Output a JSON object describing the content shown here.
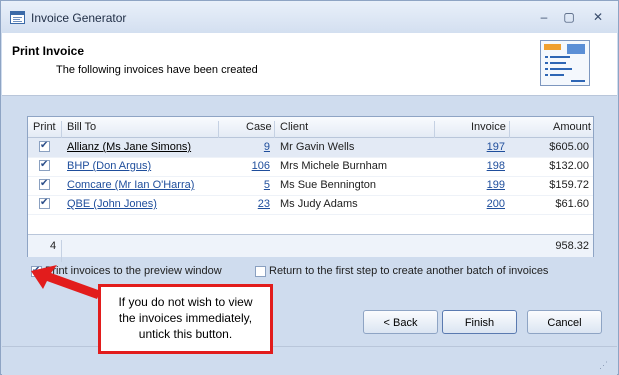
{
  "window": {
    "title": "Invoice Generator",
    "minimize": "–",
    "restore": "▢",
    "close": "✕"
  },
  "header": {
    "title": "Print Invoice",
    "subtitle": "The following invoices have been created"
  },
  "grid": {
    "columns": {
      "print": "Print",
      "bill_to": "Bill To",
      "case": "Case",
      "client": "Client",
      "invoice": "Invoice",
      "amount": "Amount"
    },
    "rows": [
      {
        "print": true,
        "bill_to": "Allianz (Ms Jane Simons)",
        "case": "9",
        "client": "Mr Gavin Wells",
        "invoice": "197",
        "amount": "$605.00"
      },
      {
        "print": true,
        "bill_to": "BHP (Don Argus)",
        "case": "106",
        "client": "Mrs Michele Burnham",
        "invoice": "198",
        "amount": "$132.00"
      },
      {
        "print": true,
        "bill_to": "Comcare (Mr Ian O'Harra)",
        "case": "5",
        "client": "Ms Sue Bennington",
        "invoice": "199",
        "amount": "$159.72"
      },
      {
        "print": true,
        "bill_to": "QBE (John Jones)",
        "case": "23",
        "client": "Ms Judy Adams",
        "invoice": "200",
        "amount": "$61.60"
      }
    ],
    "footer": {
      "count": "4",
      "total": "958.32"
    }
  },
  "options": {
    "preview_label": "Print invoices to the preview window",
    "preview_checked": true,
    "return_label": "Return to the first step to create another batch of invoices",
    "return_checked": false
  },
  "buttons": {
    "back": "< Back",
    "finish": "Finish",
    "cancel": "Cancel"
  },
  "callout": {
    "line1": "If you do not wish to view",
    "line2": "the invoices immediately,",
    "line3": "untick this button."
  },
  "colors": {
    "callout_border": "#e21c1c",
    "link": "#1f4e9c",
    "window_bg": "#cfdcee"
  }
}
